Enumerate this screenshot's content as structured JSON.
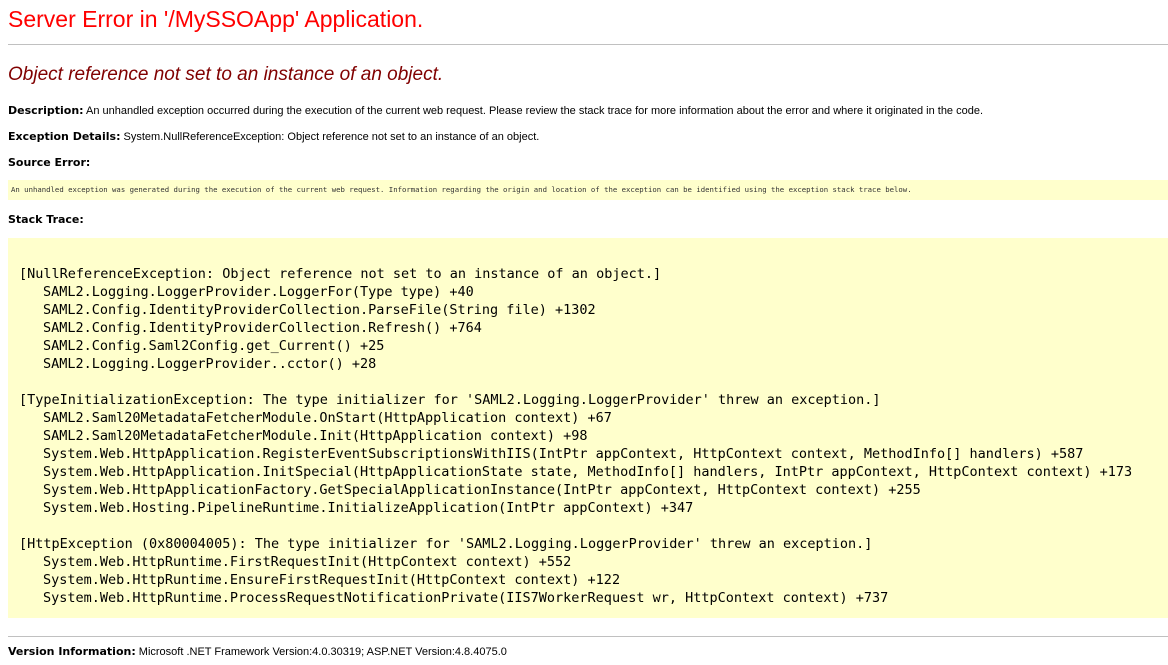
{
  "page": {
    "title": "Server Error in '/MySSOApp' Application.",
    "subtitle": "Object reference not set to an instance of an object."
  },
  "description": {
    "label": "Description:",
    "text": " An unhandled exception occurred during the execution of the current web request. Please review the stack trace for more information about the error and where it originated in the code."
  },
  "exception_details": {
    "label": "Exception Details:",
    "text": " System.NullReferenceException: Object reference not set to an instance of an object."
  },
  "source_error": {
    "label": "Source Error:",
    "text": "An unhandled exception was generated during the execution of the current web request. Information regarding the origin and location of the exception can be identified using the exception stack trace below."
  },
  "stack_trace": {
    "label": "Stack Trace:",
    "lines": [
      {
        "text": "[NullReferenceException: Object reference not set to an instance of an object.]",
        "indent": false
      },
      {
        "text": "SAML2.Logging.LoggerProvider.LoggerFor(Type type) +40",
        "indent": true
      },
      {
        "text": "SAML2.Config.IdentityProviderCollection.ParseFile(String file) +1302",
        "indent": true
      },
      {
        "text": "SAML2.Config.IdentityProviderCollection.Refresh() +764",
        "indent": true
      },
      {
        "text": "SAML2.Config.Saml2Config.get_Current() +25",
        "indent": true
      },
      {
        "text": "SAML2.Logging.LoggerProvider..cctor() +28",
        "indent": true
      },
      {
        "text": "",
        "indent": false
      },
      {
        "text": "[TypeInitializationException: The type initializer for 'SAML2.Logging.LoggerProvider' threw an exception.]",
        "indent": false
      },
      {
        "text": "SAML2.Saml20MetadataFetcherModule.OnStart(HttpApplication context) +67",
        "indent": true
      },
      {
        "text": "SAML2.Saml20MetadataFetcherModule.Init(HttpApplication context) +98",
        "indent": true
      },
      {
        "text": "System.Web.HttpApplication.RegisterEventSubscriptionsWithIIS(IntPtr appContext, HttpContext context, MethodInfo[] handlers) +587",
        "indent": true
      },
      {
        "text": "System.Web.HttpApplication.InitSpecial(HttpApplicationState state, MethodInfo[] handlers, IntPtr appContext, HttpContext context) +173",
        "indent": true
      },
      {
        "text": "System.Web.HttpApplicationFactory.GetSpecialApplicationInstance(IntPtr appContext, HttpContext context) +255",
        "indent": true
      },
      {
        "text": "System.Web.Hosting.PipelineRuntime.InitializeApplication(IntPtr appContext) +347",
        "indent": true
      },
      {
        "text": "",
        "indent": false
      },
      {
        "text": "[HttpException (0x80004005): The type initializer for 'SAML2.Logging.LoggerProvider' threw an exception.]",
        "indent": false
      },
      {
        "text": "System.Web.HttpRuntime.FirstRequestInit(HttpContext context) +552",
        "indent": true
      },
      {
        "text": "System.Web.HttpRuntime.EnsureFirstRequestInit(HttpContext context) +122",
        "indent": true
      },
      {
        "text": "System.Web.HttpRuntime.ProcessRequestNotificationPrivate(IIS7WorkerRequest wr, HttpContext context) +737",
        "indent": true
      }
    ]
  },
  "version_information": {
    "label": "Version Information:",
    "text": " Microsoft .NET Framework Version:4.0.30319; ASP.NET Version:4.8.4075.0"
  },
  "colors": {
    "title": "#ff0000",
    "subtitle": "#800000",
    "code_background": "#ffffcc",
    "rule": "#c0c0c0"
  }
}
